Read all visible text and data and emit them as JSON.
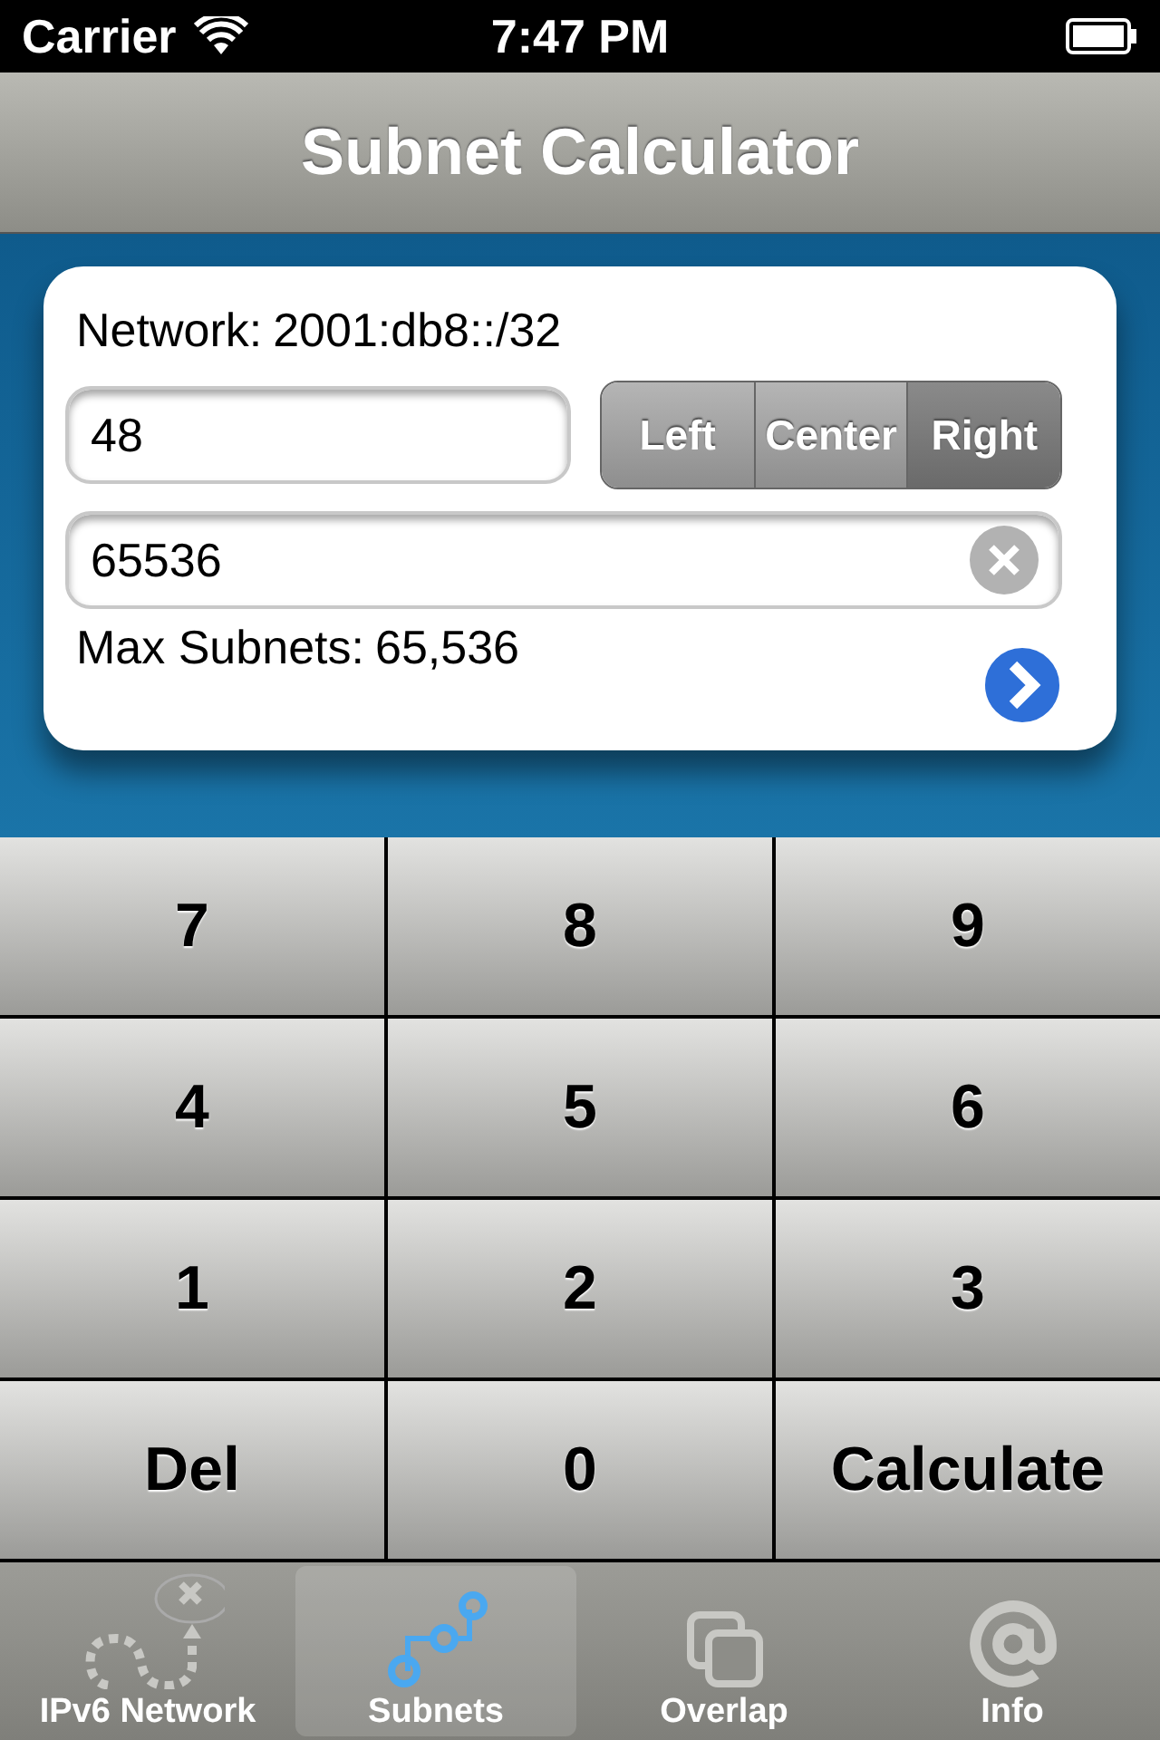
{
  "status_bar": {
    "carrier": "Carrier",
    "time": "7:47 PM"
  },
  "nav_bar": {
    "title": "Subnet Calculator"
  },
  "card": {
    "network_label": "Network:",
    "network_value": "2001:db8::/32",
    "prefix_field": {
      "value": "48"
    },
    "alignment": [
      {
        "label": "Left",
        "selected": false
      },
      {
        "label": "Center",
        "selected": false
      },
      {
        "label": "Right",
        "selected": true
      }
    ],
    "subnets_field": {
      "value": "65536"
    },
    "max_label": "Max Subnets:",
    "max_value": "65,536"
  },
  "keypad": [
    {
      "label": "7"
    },
    {
      "label": "8"
    },
    {
      "label": "9"
    },
    {
      "label": "4"
    },
    {
      "label": "5"
    },
    {
      "label": "6"
    },
    {
      "label": "1"
    },
    {
      "label": "2"
    },
    {
      "label": "3"
    },
    {
      "label": "Del"
    },
    {
      "label": "0"
    },
    {
      "label": "Calculate"
    }
  ],
  "tab_bar": [
    {
      "label": "IPv6 Network",
      "kind": "map",
      "selected": false
    },
    {
      "label": "Subnets",
      "kind": "nodes",
      "selected": true
    },
    {
      "label": "Overlap",
      "kind": "squares",
      "selected": false
    },
    {
      "label": "Info",
      "kind": "at",
      "selected": false
    }
  ]
}
